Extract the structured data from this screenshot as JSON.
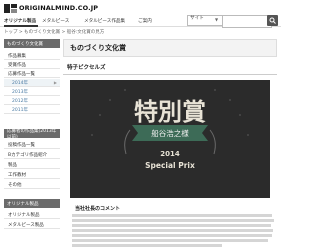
{
  "site": {
    "logo_text": "ORIGINALMIND.CO.JP"
  },
  "nav": {
    "tabs": [
      "オリジナル製品",
      "メタルピース",
      "メタルピース作品集",
      "ご案内"
    ],
    "search_select": "サイト",
    "search_placeholder": ""
  },
  "breadcrumb": "トップ > ものづくり文化賞 > 船谷:文化賞の見方",
  "sidebar": {
    "sections": [
      {
        "heading": "ものづくり文化賞",
        "items": [
          {
            "label": "作品募集"
          },
          {
            "label": "受賞作品"
          },
          {
            "label": "応募作品一覧"
          }
        ]
      },
      {
        "heading": "",
        "items": [
          {
            "label": "2014年"
          },
          {
            "label": "2013年"
          },
          {
            "label": "2012年"
          },
          {
            "label": "2011年"
          }
        ]
      },
      {
        "heading": "応募者の作品集(2013年以前)",
        "items": [
          {
            "label": "投稿作品一覧"
          },
          {
            "label": "Bカテゴリ作品紹介"
          },
          {
            "label": "製品"
          },
          {
            "label": "工作教材"
          },
          {
            "label": "その他"
          }
        ]
      },
      {
        "heading": "オリジナル製品",
        "items": [
          {
            "label": "オリジナル製品"
          },
          {
            "label": "メタルピース製品"
          }
        ]
      }
    ]
  },
  "main": {
    "title": "ものづくり文化賞",
    "section_label": "特子ピクセルズ",
    "award": {
      "main_text": "特別賞",
      "ribbon_text": "船谷浩之様",
      "year": "2014",
      "subtitle": "Special Prix"
    },
    "comment_title": "当社社長のコメント"
  },
  "colors": {
    "panel_bg": "#2b2b2b",
    "award_gold": "#e8e3d6",
    "ribbon": "#3d6b57",
    "sidebar_head": "#6b6b6b",
    "accent": "#4a7aa3"
  }
}
